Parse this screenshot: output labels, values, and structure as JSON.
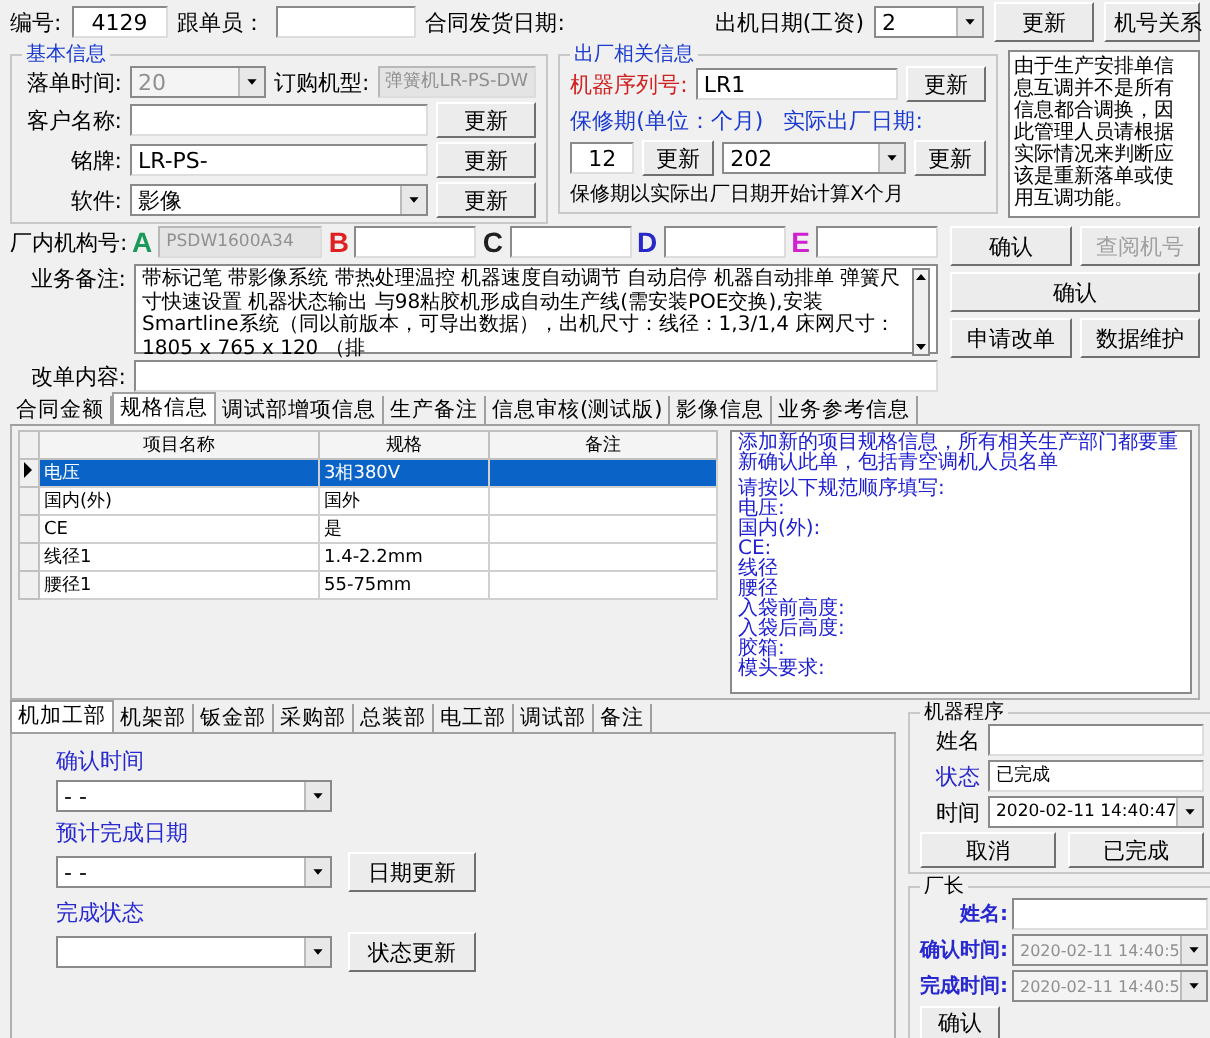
{
  "header": {
    "number_label": "编号:",
    "number": "4129",
    "follower_label": "跟单员：",
    "contract_date_label": "合同发货日期:",
    "ship_date_label": "出机日期(工资)",
    "ship_date": "2",
    "buttons": [
      "更新",
      "机号关系"
    ]
  },
  "basic_info": {
    "title": "基本信息",
    "order_time_label": "落单时间:",
    "order_time": "20",
    "model_label": "订购机型:",
    "model": "弹簧机LR-PS-DW",
    "rows": [
      {
        "label": "客户名称:",
        "value": "",
        "kind": "field",
        "button": "更新"
      },
      {
        "label": "铭牌:",
        "value": "LR-PS-",
        "kind": "field",
        "button": "更新"
      },
      {
        "label": "软件:",
        "value": "影像",
        "kind": "combo",
        "button": "更新"
      }
    ]
  },
  "factory_info": {
    "title": "出厂相关信息",
    "serial_label": "机器序列号:",
    "serial": "LR1",
    "serial_button": "更新",
    "warranty_label": "保修期(单位：个月)",
    "warranty": "12",
    "warranty_button": "更新",
    "ship_label": "实际出厂日期:",
    "ship_date": "202",
    "ship_button": "更新",
    "note": "保修期以实际出厂日期开始计算X个月"
  },
  "notice": "由于生产安排单信息互调并不是所有信息都合调换，因此管理人员请根据实际情况来判断应该是重新落单或使用互调功能。",
  "machine_no": {
    "label": "厂内机构号:",
    "codes": [
      {
        "letter": "A",
        "color": "#1a9a5a",
        "value": "PSDW1600A34",
        "disabled": true
      },
      {
        "letter": "B",
        "color": "#e02020",
        "disabled": false
      },
      {
        "letter": "C",
        "color": "#202020",
        "disabled": false
      },
      {
        "letter": "D",
        "color": "#2828c8",
        "disabled": false
      },
      {
        "letter": "E",
        "color": "#d020d0",
        "disabled": false
      }
    ]
  },
  "business_note": {
    "label": "业务备注:",
    "text": "带标记笔 带影像系统 带热处理温控 机器速度自动调节 自动启停 机器自动排单 弹簧尺寸快速设置 机器状态输出 与98粘胶机形成自动生产线(需安装POE交换),安装Smartline系统（同以前版本，可导出数据），出机尺寸：线径：1,3/1,4  床网尺寸：1805 x 765 x 120 （排"
  },
  "change_content": {
    "label": "改单内容:"
  },
  "action_buttons": [
    [
      {
        "label": "确认",
        "disabled": false
      },
      {
        "label": "查阅机号",
        "disabled": true
      }
    ],
    [
      {
        "label": "确认",
        "disabled": false
      }
    ],
    [
      {
        "label": "申请改单",
        "disabled": false
      },
      {
        "label": "数据维护",
        "disabled": false
      }
    ]
  ],
  "tabs": [
    {
      "label": "合同金额",
      "selected": false
    },
    {
      "label": "规格信息",
      "selected": true
    },
    {
      "label": "调试部增项信息",
      "selected": false
    },
    {
      "label": "生产备注",
      "selected": false
    },
    {
      "label": "信息审核(测试版)",
      "selected": false
    },
    {
      "label": "影像信息",
      "selected": false
    },
    {
      "label": "业务参考信息",
      "selected": false
    }
  ],
  "spec_table": {
    "columns": [
      "项目名称",
      "规格",
      "备注"
    ],
    "rows": [
      {
        "cells": [
          "电压",
          "3相380V",
          ""
        ],
        "selected": true
      },
      {
        "cells": [
          "国内(外)",
          "国外",
          ""
        ],
        "selected": false
      },
      {
        "cells": [
          "CE",
          "是",
          ""
        ],
        "selected": false
      },
      {
        "cells": [
          "线径1",
          "1.4-2.2mm",
          ""
        ],
        "selected": false
      },
      {
        "cells": [
          "腰径1",
          "55-75mm",
          ""
        ],
        "selected": false
      }
    ]
  },
  "spec_notes": [
    "添加新的项目规格信息，所有相关生产部门都要重新确认此单，包括青空调机人员名单",
    "请按以下规范顺序填写:",
    "电压:",
    "国内(外):",
    "CE:",
    "线径",
    "腰径",
    "入袋前高度:",
    "入袋后高度:",
    "胶箱:",
    "模头要求:"
  ],
  "dept_tabs": [
    {
      "label": "机加工部",
      "selected": true
    },
    {
      "label": "机架部",
      "selected": false
    },
    {
      "label": "钣金部",
      "selected": false
    },
    {
      "label": "采购部",
      "selected": false
    },
    {
      "label": "总装部",
      "selected": false
    },
    {
      "label": "电工部",
      "selected": false
    },
    {
      "label": "调试部",
      "selected": false
    },
    {
      "label": "备注",
      "selected": false
    }
  ],
  "dept_fields": [
    {
      "label": "确认时间",
      "value": "-  -"
    },
    {
      "label": "预计完成日期",
      "value": "-  -",
      "button": "日期更新"
    },
    {
      "label": "完成状态",
      "button": "状态更新"
    }
  ],
  "machine_program": {
    "title": "机器程序",
    "fields": [
      {
        "label": "姓名",
        "kind": "field",
        "color": "#000000"
      },
      {
        "label": "状态",
        "value": "已完成",
        "kind": "field",
        "color": "#2828c8"
      },
      {
        "label": "时间",
        "value": "2020-02-11 14:40:47",
        "kind": "combo",
        "color": "#000000"
      }
    ],
    "buttons": [
      "取消",
      "已完成"
    ]
  },
  "director": {
    "title": "厂长",
    "fields": [
      {
        "label": "姓名:",
        "kind": "field",
        "disabled": false
      },
      {
        "label": "确认时间:",
        "value": "2020-02-11 14:40:5",
        "kind": "combo",
        "disabled": true
      },
      {
        "label": "完成时间:",
        "value": "2020-02-11 14:40:5",
        "kind": "combo",
        "disabled": true
      }
    ],
    "buttons": [
      "确认"
    ]
  }
}
